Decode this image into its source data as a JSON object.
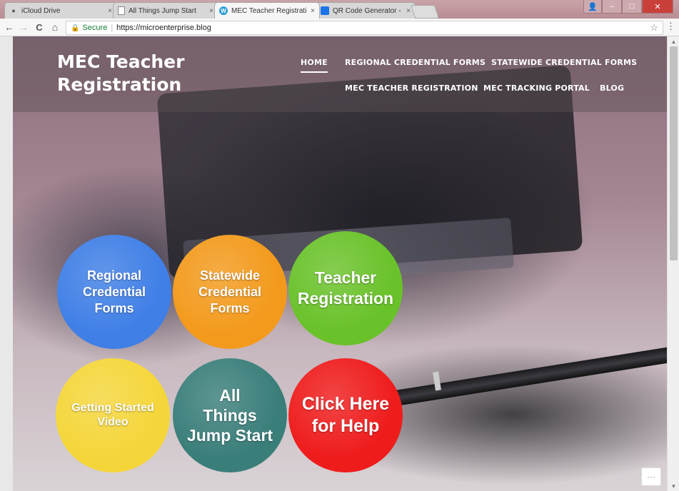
{
  "browser": {
    "tabs": [
      {
        "label": "iCloud Drive",
        "icon": "apple-icon",
        "close": "×"
      },
      {
        "label": "All Things Jump Start",
        "icon": "page-icon",
        "close": "×"
      },
      {
        "label": "MEC Teacher Registratio",
        "icon": "wordpress-icon",
        "close": "×"
      },
      {
        "label": "QR Code Generator - Cr",
        "icon": "qr-icon",
        "close": "×"
      }
    ],
    "window_controls": {
      "user": "👤",
      "minimize": "–",
      "maximize": "□",
      "close": "✕"
    },
    "nav": {
      "back": "←",
      "forward": "→",
      "reload": "C",
      "home": "⌂"
    },
    "address": {
      "lock": "🔒",
      "secure_label": "Secure",
      "separator": "|",
      "url": "https://microenterprise.blog",
      "bookmark": "☆"
    },
    "menu": "⋮"
  },
  "site": {
    "title": "MEC Teacher Registration",
    "nav": [
      {
        "label": "HOME"
      },
      {
        "label": "REGIONAL CREDENTIAL FORMS"
      },
      {
        "label": "STATEWIDE CREDENTIAL FORMS"
      },
      {
        "label": "MEC TEACHER REGISTRATION"
      },
      {
        "label": "MEC TRACKING PORTAL"
      },
      {
        "label": "BLOG"
      }
    ],
    "circles": [
      {
        "label": "Regional\nCredential\nForms",
        "color": "#3f7fe6"
      },
      {
        "label": "Statewide\nCredential\nForms",
        "color": "#f39a1c"
      },
      {
        "label": "Teacher\nRegistration",
        "color": "#6ac22a"
      },
      {
        "label": "Getting Started\nVideo",
        "color": "#f5d63a"
      },
      {
        "label": "All\nThings\nJump Start",
        "color": "#3a7e7a"
      },
      {
        "label": "Click Here\nfor Help",
        "color": "#ef1c1c"
      }
    ]
  },
  "scrollbar": {
    "up": "▲",
    "down": "▼"
  },
  "more_button": "···"
}
